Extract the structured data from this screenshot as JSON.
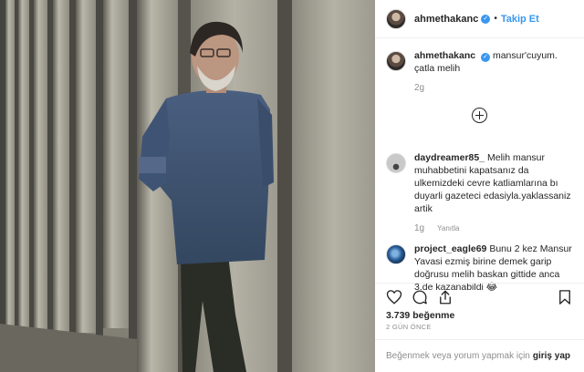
{
  "post": {
    "username": "ahmethakanc",
    "verified_mark": "✓",
    "dot": "•",
    "follow_label": "Takip Et"
  },
  "caption": {
    "username": "ahmethakanc",
    "text": "mansur'cuyum. çatla melih",
    "time": "2g"
  },
  "comments": [
    {
      "username": "daydreamer85_",
      "text": "Melih mansur muhabbetini kapatsanız da ulkemizdeki cevre katliamlarına bı duyarli gazeteci edasiyla.yaklassaniz artik",
      "time": "1g",
      "reply_label": "Yanıtla"
    },
    {
      "username": "project_eagle69",
      "text": "Bunu 2 kez Mansur Yavasi ezmiş birine demek garip doğrusu melih baskan gittide anca 3.de kazanabildi 😂"
    }
  ],
  "likes": "3.739 beğenme",
  "time_ago": "2 GÜN ÖNCE",
  "login": {
    "prompt": "Beğenmek veya yorum yapmak için",
    "link": "giriş yap"
  },
  "icons": {
    "like": "heart-icon",
    "comment": "comment-icon",
    "share": "share-icon",
    "save": "bookmark-icon",
    "more": "plus-circle-icon"
  },
  "colors": {
    "link_blue": "#3897f0",
    "text": "#262626",
    "muted": "#8e8e8e"
  }
}
